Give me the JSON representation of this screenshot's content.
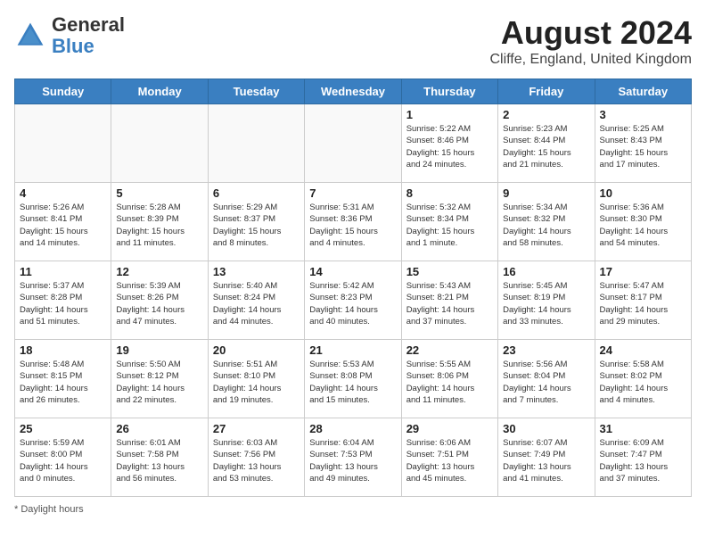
{
  "header": {
    "logo_general": "General",
    "logo_blue": "Blue",
    "month_year": "August 2024",
    "location": "Cliffe, England, United Kingdom"
  },
  "days_of_week": [
    "Sunday",
    "Monday",
    "Tuesday",
    "Wednesday",
    "Thursday",
    "Friday",
    "Saturday"
  ],
  "footer": {
    "note": "Daylight hours"
  },
  "weeks": [
    [
      {
        "day": "",
        "info": ""
      },
      {
        "day": "",
        "info": ""
      },
      {
        "day": "",
        "info": ""
      },
      {
        "day": "",
        "info": ""
      },
      {
        "day": "1",
        "info": "Sunrise: 5:22 AM\nSunset: 8:46 PM\nDaylight: 15 hours\nand 24 minutes."
      },
      {
        "day": "2",
        "info": "Sunrise: 5:23 AM\nSunset: 8:44 PM\nDaylight: 15 hours\nand 21 minutes."
      },
      {
        "day": "3",
        "info": "Sunrise: 5:25 AM\nSunset: 8:43 PM\nDaylight: 15 hours\nand 17 minutes."
      }
    ],
    [
      {
        "day": "4",
        "info": "Sunrise: 5:26 AM\nSunset: 8:41 PM\nDaylight: 15 hours\nand 14 minutes."
      },
      {
        "day": "5",
        "info": "Sunrise: 5:28 AM\nSunset: 8:39 PM\nDaylight: 15 hours\nand 11 minutes."
      },
      {
        "day": "6",
        "info": "Sunrise: 5:29 AM\nSunset: 8:37 PM\nDaylight: 15 hours\nand 8 minutes."
      },
      {
        "day": "7",
        "info": "Sunrise: 5:31 AM\nSunset: 8:36 PM\nDaylight: 15 hours\nand 4 minutes."
      },
      {
        "day": "8",
        "info": "Sunrise: 5:32 AM\nSunset: 8:34 PM\nDaylight: 15 hours\nand 1 minute."
      },
      {
        "day": "9",
        "info": "Sunrise: 5:34 AM\nSunset: 8:32 PM\nDaylight: 14 hours\nand 58 minutes."
      },
      {
        "day": "10",
        "info": "Sunrise: 5:36 AM\nSunset: 8:30 PM\nDaylight: 14 hours\nand 54 minutes."
      }
    ],
    [
      {
        "day": "11",
        "info": "Sunrise: 5:37 AM\nSunset: 8:28 PM\nDaylight: 14 hours\nand 51 minutes."
      },
      {
        "day": "12",
        "info": "Sunrise: 5:39 AM\nSunset: 8:26 PM\nDaylight: 14 hours\nand 47 minutes."
      },
      {
        "day": "13",
        "info": "Sunrise: 5:40 AM\nSunset: 8:24 PM\nDaylight: 14 hours\nand 44 minutes."
      },
      {
        "day": "14",
        "info": "Sunrise: 5:42 AM\nSunset: 8:23 PM\nDaylight: 14 hours\nand 40 minutes."
      },
      {
        "day": "15",
        "info": "Sunrise: 5:43 AM\nSunset: 8:21 PM\nDaylight: 14 hours\nand 37 minutes."
      },
      {
        "day": "16",
        "info": "Sunrise: 5:45 AM\nSunset: 8:19 PM\nDaylight: 14 hours\nand 33 minutes."
      },
      {
        "day": "17",
        "info": "Sunrise: 5:47 AM\nSunset: 8:17 PM\nDaylight: 14 hours\nand 29 minutes."
      }
    ],
    [
      {
        "day": "18",
        "info": "Sunrise: 5:48 AM\nSunset: 8:15 PM\nDaylight: 14 hours\nand 26 minutes."
      },
      {
        "day": "19",
        "info": "Sunrise: 5:50 AM\nSunset: 8:12 PM\nDaylight: 14 hours\nand 22 minutes."
      },
      {
        "day": "20",
        "info": "Sunrise: 5:51 AM\nSunset: 8:10 PM\nDaylight: 14 hours\nand 19 minutes."
      },
      {
        "day": "21",
        "info": "Sunrise: 5:53 AM\nSunset: 8:08 PM\nDaylight: 14 hours\nand 15 minutes."
      },
      {
        "day": "22",
        "info": "Sunrise: 5:55 AM\nSunset: 8:06 PM\nDaylight: 14 hours\nand 11 minutes."
      },
      {
        "day": "23",
        "info": "Sunrise: 5:56 AM\nSunset: 8:04 PM\nDaylight: 14 hours\nand 7 minutes."
      },
      {
        "day": "24",
        "info": "Sunrise: 5:58 AM\nSunset: 8:02 PM\nDaylight: 14 hours\nand 4 minutes."
      }
    ],
    [
      {
        "day": "25",
        "info": "Sunrise: 5:59 AM\nSunset: 8:00 PM\nDaylight: 14 hours\nand 0 minutes."
      },
      {
        "day": "26",
        "info": "Sunrise: 6:01 AM\nSunset: 7:58 PM\nDaylight: 13 hours\nand 56 minutes."
      },
      {
        "day": "27",
        "info": "Sunrise: 6:03 AM\nSunset: 7:56 PM\nDaylight: 13 hours\nand 53 minutes."
      },
      {
        "day": "28",
        "info": "Sunrise: 6:04 AM\nSunset: 7:53 PM\nDaylight: 13 hours\nand 49 minutes."
      },
      {
        "day": "29",
        "info": "Sunrise: 6:06 AM\nSunset: 7:51 PM\nDaylight: 13 hours\nand 45 minutes."
      },
      {
        "day": "30",
        "info": "Sunrise: 6:07 AM\nSunset: 7:49 PM\nDaylight: 13 hours\nand 41 minutes."
      },
      {
        "day": "31",
        "info": "Sunrise: 6:09 AM\nSunset: 7:47 PM\nDaylight: 13 hours\nand 37 minutes."
      }
    ]
  ]
}
